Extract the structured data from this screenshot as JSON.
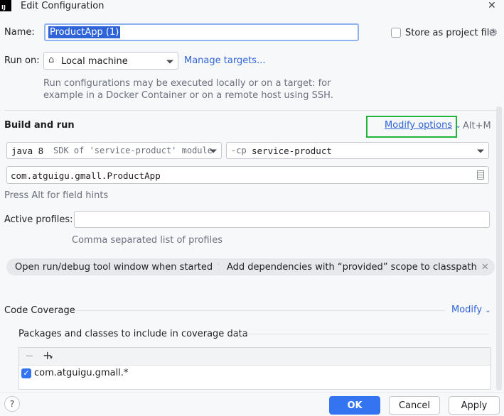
{
  "window": {
    "title": "Edit Configuration",
    "app_icon_text": "IJ",
    "close_glyph": "✕"
  },
  "name_row": {
    "label": "Name:",
    "value": "ProductApp (1)",
    "store_label": "Store as project file",
    "store_checked": false
  },
  "run_on": {
    "label": "Run on:",
    "value": "Local machine",
    "manage_link": "Manage targets...",
    "hint_line1": "Run configurations may be executed locally or on a target: for",
    "hint_line2": "example in a Docker Container or on a remote host using SSH."
  },
  "build_and_run": {
    "title": "Build and run",
    "modify_options": "Modify options",
    "shortcut": "Alt+M",
    "jdk_version": "java 8",
    "jdk_desc": "SDK of 'service-product' module",
    "cp_flag": "-cp",
    "cp_value": "service-product",
    "main_class": "com.atguigu.gmall.ProductApp",
    "field_hint": "Press Alt for field hints"
  },
  "profiles": {
    "label": "Active profiles:",
    "value": "",
    "hint": "Comma separated list of profiles"
  },
  "chips": [
    {
      "label": "Open run/debug tool window when started"
    },
    {
      "label": "Add dependencies with “provided” scope to classpath"
    }
  ],
  "coverage": {
    "title": "Code Coverage",
    "modify": "Modify",
    "packages_title": "Packages and classes to include in coverage data",
    "toolbar_remove": "−",
    "toolbar_add": "+",
    "items": [
      {
        "label": "com.atguigu.gmall.*",
        "checked": true
      }
    ]
  },
  "footer": {
    "help": "?",
    "ok": "OK",
    "cancel": "Cancel",
    "apply": "Apply"
  },
  "colors": {
    "accent": "#3574f0",
    "highlight_box": "#1fb43a",
    "link": "#2f63d8"
  }
}
